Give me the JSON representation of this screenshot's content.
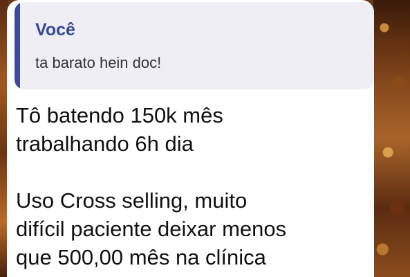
{
  "reply": {
    "author": "Você",
    "text": "ta barato hein doc!"
  },
  "message": {
    "lines": [
      "Tô batendo 150k mês",
      "trabalhando 6h dia",
      "Uso Cross selling, muito",
      "difícil paciente deixar menos",
      "que 500,00 mês na clínica"
    ]
  },
  "colors": {
    "accent": "#34479a",
    "quote_background": "#efeef4",
    "bubble_background": "#ffffff"
  }
}
